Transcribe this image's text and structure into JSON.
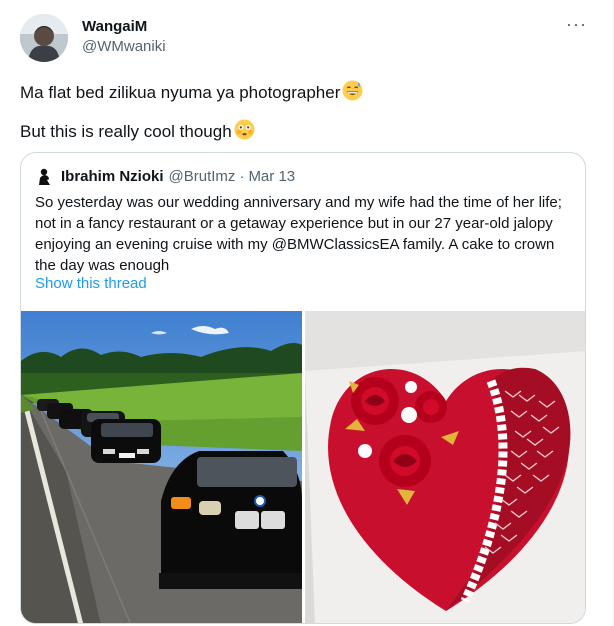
{
  "author": {
    "name": "WangaiM",
    "handle": "@WMwaniki",
    "avatar_icon": "user-avatar"
  },
  "more_icon": "ellipsis-icon",
  "tweet": {
    "line1": "Ma flat bed zilikua nyuma ya photographer",
    "line1_emoji": "grinning-sweat-emoji",
    "line2": "But this is really cool though",
    "line2_emoji": "flushed-face-emoji"
  },
  "quoted": {
    "author_name": "Ibrahim Nzioki",
    "handle": "@BrutImz",
    "separator": "·",
    "date": "Mar 13",
    "text": "So yesterday was our wedding anniversary and my wife had the time of her life; not in a fancy restaurant or a getaway experience but in our 27 year-old jalopy enjoying an evening cruise with my @BMWClassicsEA family. A cake to crown the day was enough",
    "show_thread": "Show this thread",
    "photos": [
      "bmw-cars-roadside-photo",
      "heart-cake-photo"
    ]
  },
  "colors": {
    "text": "#0f1419",
    "muted": "#536471",
    "link": "#1d9bf0",
    "border": "#cfd9de",
    "cake_red": "#c8102e"
  }
}
